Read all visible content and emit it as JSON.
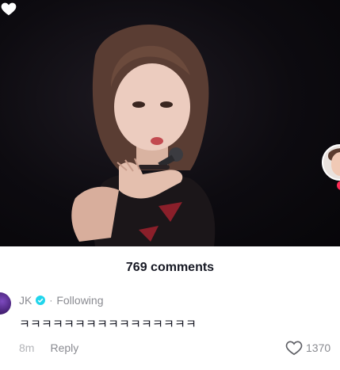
{
  "comments_panel": {
    "count_label": "769 comments"
  },
  "comment": {
    "author": "JK",
    "relation": "Following",
    "separator": "·",
    "text": "ㅋㅋㅋㅋㅋㅋㅋㅋㅋㅋㅋㅋㅋㅋㅋㅋ",
    "time": "8m",
    "reply_label": "Reply",
    "like_count": "1370"
  },
  "icons": {
    "verified": "verified-badge-icon",
    "like": "heart-outline-icon"
  },
  "colors": {
    "verified": "#20d5ec",
    "avatar": "#5b2c8f",
    "text_primary": "#161823",
    "text_secondary": "#8a8b91"
  }
}
